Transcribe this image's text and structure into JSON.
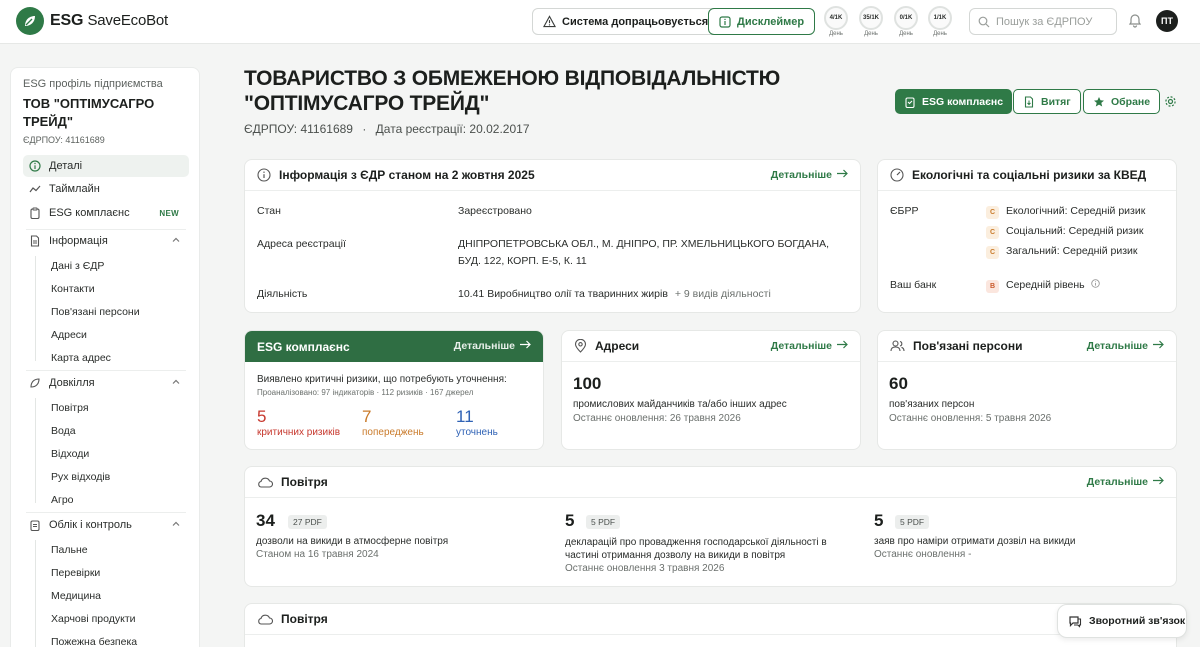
{
  "app": {
    "logo_text": "ESG",
    "logo_text2": "SaveEcoBot"
  },
  "topbar": {
    "status_label": "Система допрацьовується",
    "disclaimer_label": "Дисклеймер",
    "quotas": [
      {
        "value": "4/1K",
        "period": "День"
      },
      {
        "value": "35/1K",
        "period": "День"
      },
      {
        "value": "0/1K",
        "period": "День"
      },
      {
        "value": "1/1K",
        "period": "День"
      }
    ],
    "search_placeholder": "Пошук за ЄДРПОУ",
    "avatar_initials": "ПТ"
  },
  "sidebar": {
    "subtitle": "ESG профіль підприємства",
    "company": "ТОВ \"ОПТІМУСАГРО ТРЕЙД\"",
    "code": "ЄДРПОУ: 41161689",
    "items": [
      {
        "label": "Деталі"
      },
      {
        "label": "Таймлайн"
      },
      {
        "label": "ESG комплаєнс",
        "badge": "NEW"
      },
      {
        "label": "Інформація"
      },
      {
        "label": "Довкілля"
      },
      {
        "label": "Облік і контроль"
      }
    ],
    "info_children": [
      "Дані з ЄДР",
      "Контакти",
      "Пов'язані персони",
      "Адреси",
      "Карта адрес"
    ],
    "env_children": [
      "Повітря",
      "Вода",
      "Відходи",
      "Рух відходів",
      "Агро"
    ],
    "control_children": [
      "Пальне",
      "Перевірки",
      "Медицина",
      "Харчові продукти",
      "Пожежна безпека"
    ]
  },
  "header": {
    "title": "ТОВАРИСТВО З ОБМЕЖЕНОЮ ВІДПОВІДАЛЬНІСТЮ \"ОПТІМУСАГРО ТРЕЙД\"",
    "code": "ЄДРПОУ: 41161689",
    "separator": "·",
    "reg_date": "Дата реєстрації: 20.02.2017",
    "btn_esg": "ESG комплаєнс",
    "btn_extract": "Витяг",
    "btn_fav": "Обране"
  },
  "edr": {
    "title": "Інформація з ЄДР станом на 2 жовтня 2025",
    "more": "Детальніше",
    "rows": [
      {
        "label": "Стан",
        "value": "Зареєстровано"
      },
      {
        "label": "Адреса реєстрації",
        "value": "ДНІПРОПЕТРОВСЬКА ОБЛ., М. ДНІПРО, ПР. ХМЕЛЬНИЦЬКОГО БОГДАНА, БУД. 122, КОРП. Е-5, К. 11"
      },
      {
        "label": "Діяльність",
        "value": "10.41 Виробництво олії та тваринних жирів",
        "extra": "+ 9 видів діяльності"
      }
    ]
  },
  "risks": {
    "title": "Екологічні та соціальні ризики за КВЕД",
    "ebrd_label": "ЄБРР",
    "ebrd": [
      {
        "grade": "С",
        "text": "Екологічний: Середній ризик"
      },
      {
        "grade": "С",
        "text": "Соціальний: Середній ризик"
      },
      {
        "grade": "С",
        "text": "Загальний: Середній ризик"
      }
    ],
    "bank_label": "Ваш банк",
    "bank": {
      "grade": "В",
      "text": "Середній рівень"
    }
  },
  "esg": {
    "title": "ESG комплаєнс",
    "more": "Детальніше",
    "note": "Виявлено критичні ризики, що потребують уточнення:",
    "analyzed": "Проаналізовано: 97 індикаторів · 112 ризиків · 167 джерел",
    "stats": [
      {
        "value": "5",
        "label": "критичних ризиків",
        "color": "#c7392f"
      },
      {
        "value": "7",
        "label": "попереджень",
        "color": "#c97a2a"
      },
      {
        "value": "11",
        "label": "уточнень",
        "color": "#2f62b5"
      }
    ]
  },
  "addresses": {
    "title": "Адреси",
    "more": "Детальніше",
    "count": "100",
    "desc": "промислових майданчиків та/або інших адрес",
    "updated": "Останнє оновлення: 26 травня 2026"
  },
  "persons": {
    "title": "Пов'язані персони",
    "more": "Детальніше",
    "count": "60",
    "desc": "пов'язаних персон",
    "updated": "Останнє оновлення: 5 травня 2026"
  },
  "air": {
    "title": "Повітря",
    "more": "Детальніше",
    "cols": [
      {
        "count": "34",
        "pdf": "27 PDF",
        "desc": "дозволи на викиди в атмосферне повітря",
        "date": "Станом на 16 травня 2024"
      },
      {
        "count": "5",
        "pdf": "5 PDF",
        "desc": "декларацій про провадження господарської діяльності в частині отримання дозволу на викиди в повітря",
        "date": "Останнє оновлення 3 травня 2026"
      },
      {
        "count": "5",
        "pdf": "5 PDF",
        "desc": "заяв про наміри отримати дозвіл на викиди",
        "date": "Останнє оновлення -"
      }
    ]
  },
  "air2": {
    "title": "Повітря"
  },
  "feedback": {
    "label": "Зворотний зв'язок"
  },
  "colors": {
    "accent": "#2f7a47",
    "background": "#f4f5f4"
  }
}
